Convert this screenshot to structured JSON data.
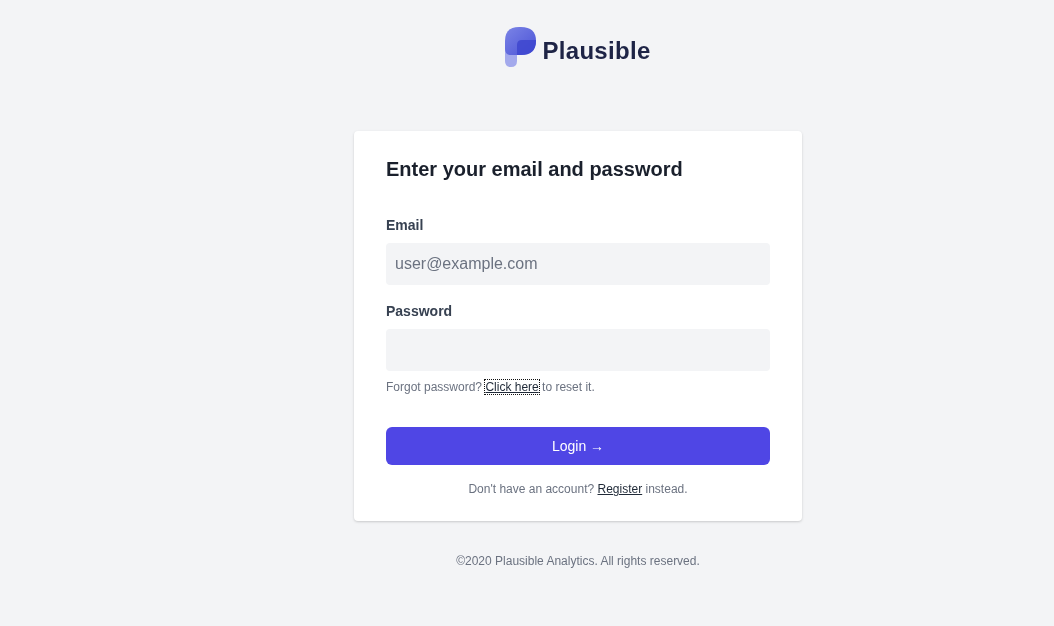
{
  "logo": {
    "wordmark": "Plausible"
  },
  "card": {
    "title": "Enter your email and password",
    "fields": [
      {
        "label": "Email",
        "placeholder": "user@example.com"
      },
      {
        "label": "Password"
      }
    ],
    "forgot": {
      "before": "Forgot password?",
      "link": {
        "label": "Click here",
        "focused": true
      },
      "after": "to reset it."
    },
    "submit": {
      "label": "Login →"
    },
    "register": {
      "before": "Don't have an account?",
      "link": {
        "label": "Register",
        "focused": false
      },
      "after": "instead."
    }
  },
  "footer": "©2020 Plausible Analytics. All rights reserved."
}
